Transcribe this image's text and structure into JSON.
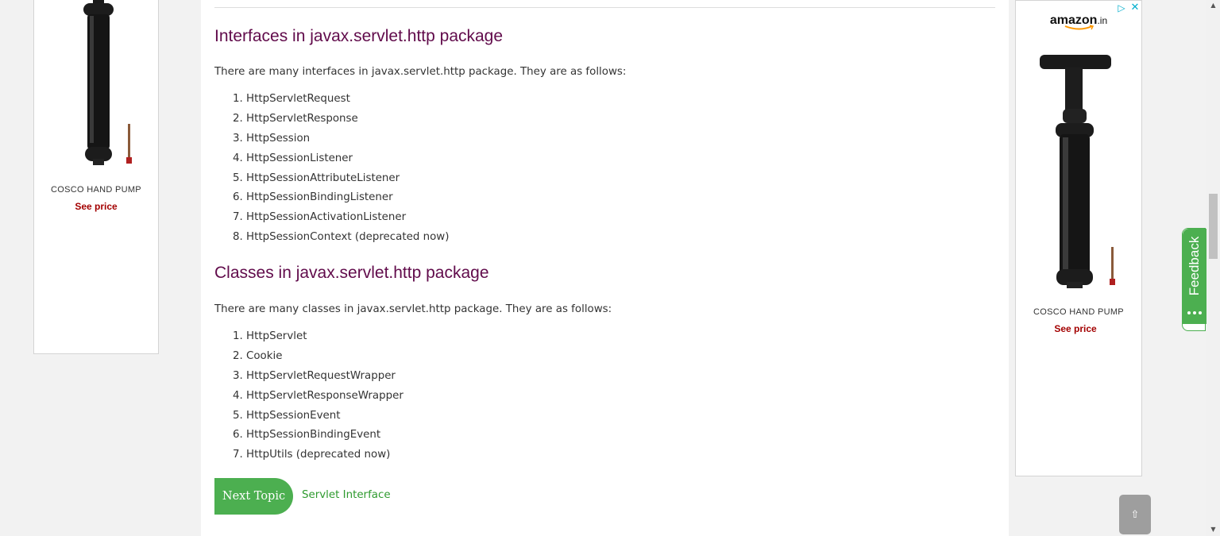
{
  "left_ad": {
    "product_name": "COSCO HAND PUMP",
    "price_label": "See price"
  },
  "main": {
    "interfaces": {
      "heading": "Interfaces in javax.servlet.http package",
      "intro": "There are many interfaces in javax.servlet.http package. They are as follows:",
      "items": [
        "HttpServletRequest",
        "HttpServletResponse",
        "HttpSession",
        "HttpSessionListener",
        "HttpSessionAttributeListener",
        "HttpSessionBindingListener",
        "HttpSessionActivationListener",
        "HttpSessionContext (deprecated now)"
      ]
    },
    "classes": {
      "heading": "Classes in javax.servlet.http package",
      "intro": "There are many classes in javax.servlet.http package. They are as follows:",
      "items": [
        "HttpServlet",
        "Cookie",
        "HttpServletRequestWrapper",
        "HttpServletResponseWrapper",
        "HttpSessionEvent",
        "HttpSessionBindingEvent",
        "HttpUtils (deprecated now)"
      ]
    },
    "next_topic_button": "Next Topic",
    "next_topic_link": "Servlet Interface"
  },
  "right_ad": {
    "brand": "amazon",
    "brand_suffix": ".in",
    "product_name": "COSCO HAND PUMP",
    "price_label": "See price",
    "adchoices_icon": "adchoices-icon",
    "close_icon": "close-icon"
  },
  "feedback_label": "Feedback",
  "scroll_top_icon": "arrow-up-icon",
  "colors": {
    "heading": "#610b4b",
    "accent_green": "#4caf50",
    "link_green": "#2e9a2e",
    "price_red": "#a30000"
  }
}
